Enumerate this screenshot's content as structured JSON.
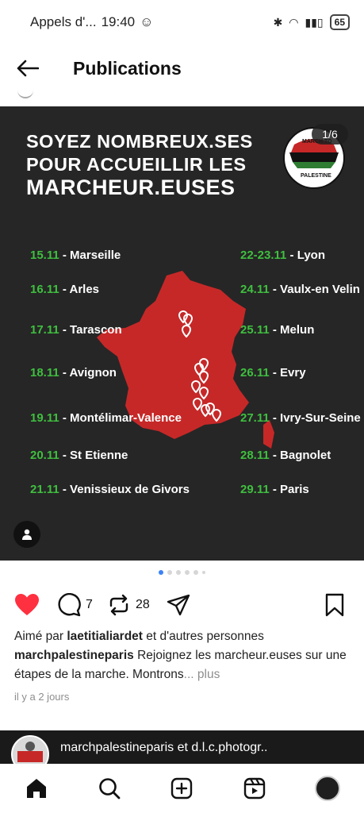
{
  "status_bar": {
    "carrier": "Appels d'...",
    "time": "19:40",
    "battery": "65"
  },
  "header": {
    "title": "Publications"
  },
  "post": {
    "image": {
      "headline": [
        "SOYEZ NOMBREUX.SES",
        "POUR ACCUEILLIR LES",
        "MARCHEUR.EUSES"
      ],
      "counter": "1/6",
      "logo_text_top": "MARCH TO",
      "logo_text_bottom": "PALESTINE",
      "stops_left": [
        {
          "date": "15.11",
          "place": " - Marseille"
        },
        {
          "date": "16.11",
          "place": " - Arles"
        },
        {
          "date": "17.11",
          "place": " - Tarascon"
        },
        {
          "date": "18.11",
          "place": " - Avignon"
        },
        {
          "date": "19.11",
          "place": " - Montélimar-Valence"
        },
        {
          "date": "20.11",
          "place": " - St Etienne"
        },
        {
          "date": "21.11",
          "place": " - Venissieux de Givors"
        }
      ],
      "stops_right": [
        {
          "date": "22-23.11",
          "place": " - Lyon"
        },
        {
          "date": "24.11",
          "place": " - Vaulx-en Velin"
        },
        {
          "date": "25.11",
          "place": " - Melun"
        },
        {
          "date": "26.11",
          "place": " - Evry"
        },
        {
          "date": "27.11",
          "place": " - Ivry-Sur-Seine"
        },
        {
          "date": "28.11",
          "place": " - Bagnolet"
        },
        {
          "date": "29.11",
          "place": " - Paris"
        }
      ],
      "colors": {
        "background": "#262626",
        "map": "#c62828",
        "date": "#3fbf3f"
      }
    },
    "counts": {
      "comments": "7",
      "reposts": "28"
    },
    "liked_by_prefix": "Aimé par ",
    "liked_by_user": "laetitialiardet",
    "liked_by_suffix": " et d'autres personnes",
    "author": "marchpalestineparis",
    "caption": " Rejoignez les marcheur.euses sur une étapes de la marche. Montrons",
    "more": "... plus",
    "time": "il y a 2 jours"
  },
  "next_post": {
    "title": "marchpalestineparis et d.l.c.photogr.."
  },
  "icons": [
    "back-arrow-icon",
    "heart-icon",
    "comment-icon",
    "repost-icon",
    "share-icon",
    "bookmark-icon",
    "home-icon",
    "search-icon",
    "create-icon",
    "reels-icon",
    "user-tag-icon",
    "location-pin-icon"
  ]
}
